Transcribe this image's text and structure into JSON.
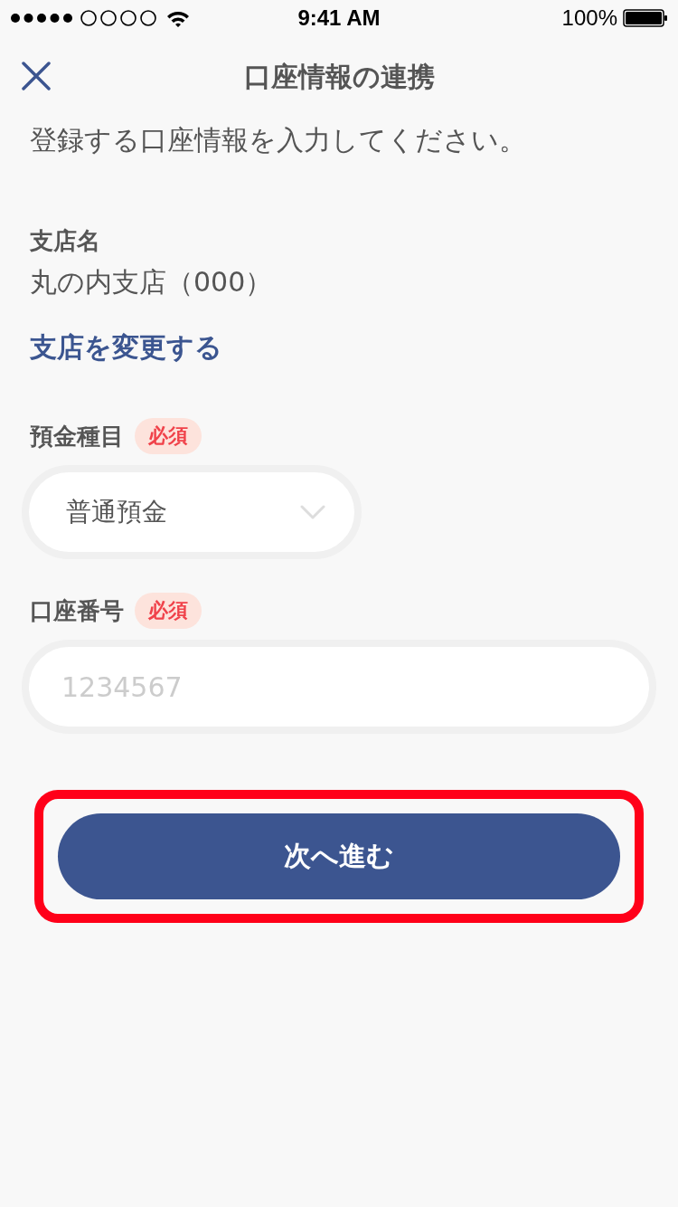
{
  "status_bar": {
    "time": "9:41 AM",
    "battery_text": "100%"
  },
  "nav_bar": {
    "title": "口座情報の連携"
  },
  "instruction": "登録する口座情報を入力してください。",
  "branch": {
    "label": "支店名",
    "value": "丸の内支店（000）",
    "change_link": "支店を変更する"
  },
  "fields": [
    {
      "kind": "select",
      "label": "預金種目",
      "required_badge": "必須",
      "value": "普通預金"
    },
    {
      "kind": "input",
      "label": "口座番号",
      "required_badge": "必須",
      "placeholder": "1234567"
    }
  ],
  "next_button": {
    "label": "次へ進む",
    "highlighted": true
  }
}
